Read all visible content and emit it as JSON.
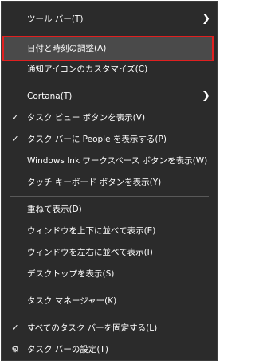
{
  "menu": {
    "toolbar": {
      "label": "ツール バー(T)",
      "arrow": "❯"
    },
    "datetime": {
      "label": "日付と時刻の調整(A)"
    },
    "notify_icons": {
      "label": "通知アイコンのカスタマイズ(C)"
    },
    "cortana": {
      "label": "Cortana(T)",
      "arrow": "❯"
    },
    "task_view": {
      "label": "タスク ビュー ボタンを表示(V)",
      "check": "✓"
    },
    "people": {
      "label": "タスク バーに People を表示する(P)",
      "check": "✓"
    },
    "ink_workspace": {
      "label": "Windows Ink ワークスペース ボタンを表示(W)"
    },
    "touch_keyboard": {
      "label": "タッチ キーボード ボタンを表示(Y)"
    },
    "cascade": {
      "label": "重ねて表示(D)"
    },
    "stack_vertical": {
      "label": "ウィンドウを上下に並べて表示(E)"
    },
    "side_by_side": {
      "label": "ウィンドウを左右に並べて表示(I)"
    },
    "show_desktop": {
      "label": "デスクトップを表示(S)"
    },
    "task_manager": {
      "label": "タスク マネージャー(K)"
    },
    "lock_taskbars": {
      "label": "すべてのタスク バーを固定する(L)",
      "check": "✓"
    },
    "taskbar_settings": {
      "label": "タスク バーの設定(T)",
      "icon": "⚙"
    }
  },
  "colors": {
    "menu_bg": "#2b2b2b",
    "highlight_bg": "#4a4a4a",
    "highlight_border": "#e02020",
    "separator": "#595959",
    "text": "#ffffff"
  }
}
